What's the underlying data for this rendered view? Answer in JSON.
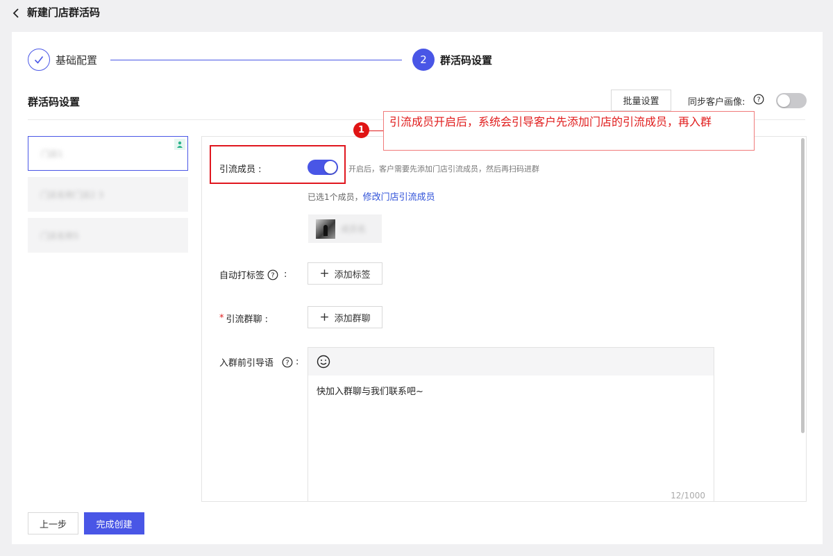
{
  "header": {
    "title": "新建门店群活码"
  },
  "steps": [
    {
      "label": "基础配置",
      "status": "done"
    },
    {
      "label": "群活码设置",
      "number": "2",
      "status": "active"
    }
  ],
  "section": {
    "title": "群活码设置",
    "batch_button": "批量设置",
    "sync_label": "同步客户画像:",
    "sync_enabled": false
  },
  "store_list": [
    {
      "name": "门店1",
      "selected": true
    },
    {
      "name": "门店名称门店2 3",
      "selected": false
    },
    {
      "name": "门店名称5",
      "selected": false
    }
  ],
  "form": {
    "lead_member": {
      "label": "引流成员 :",
      "enabled": true,
      "hint": "开启后，客户需要先添加门店引流成员，然后再扫码进群",
      "selected_text": "已选1个成员，",
      "modify_link": "修改门店引流成员",
      "member_name": "成员名"
    },
    "auto_tag": {
      "label": "自动打标签",
      "colon": ":",
      "button": "添加标签"
    },
    "lead_group": {
      "required": "*",
      "label": "引流群聊 :",
      "button": "添加群聊"
    },
    "guide_text": {
      "label": "入群前引导语",
      "colon": ":",
      "content": "快加入群聊与我们联系吧~",
      "counter": "12/1000"
    }
  },
  "annotation": {
    "number": "1",
    "text": "引流成员开启后，系统会引导客户先添加门店的引流成员，再入群"
  },
  "footer": {
    "prev": "上一步",
    "finish": "完成创建"
  },
  "colors": {
    "primary": "#4956e6",
    "annotation": "#e0161e",
    "link": "#2e50d8"
  }
}
